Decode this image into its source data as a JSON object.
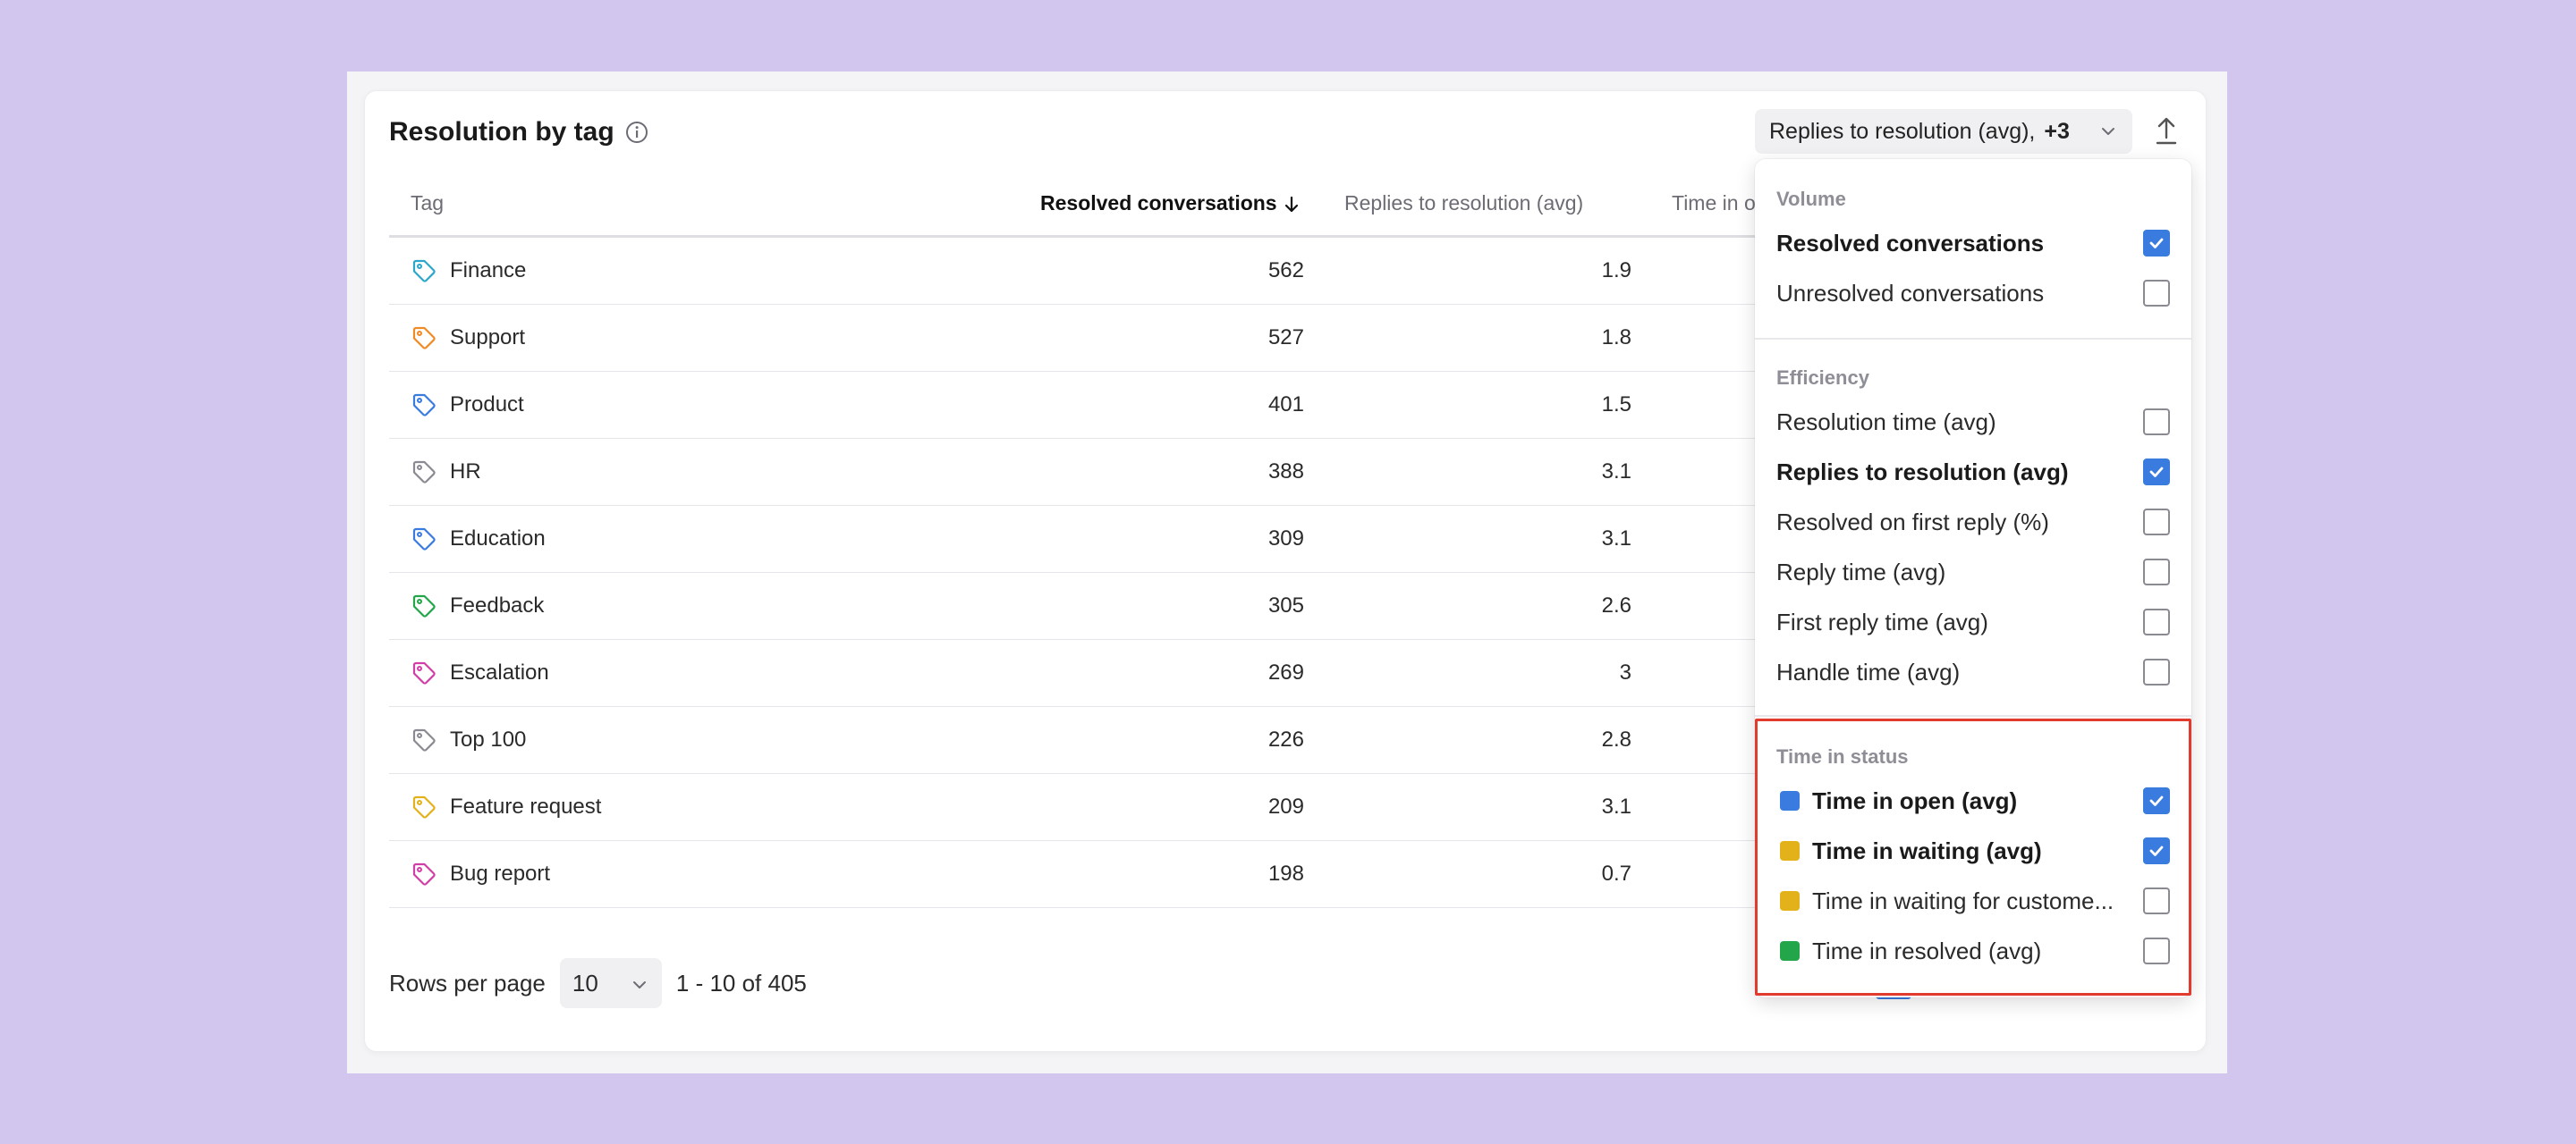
{
  "card": {
    "title": "Resolution by tag",
    "metric_select": {
      "value": "Replies to resolution (avg),",
      "extra": "+3"
    }
  },
  "table": {
    "headers": {
      "tag": "Tag",
      "resolved": "Resolved conversations",
      "replies": "Replies to resolution (avg)",
      "time_in": "Time in o"
    },
    "sort": {
      "column": "Resolved conversations",
      "direction": "descending"
    },
    "rows": [
      {
        "tag": "Finance",
        "color": "#2aa7c9",
        "resolved": "562",
        "replies": "1.9"
      },
      {
        "tag": "Support",
        "color": "#f08a24",
        "resolved": "527",
        "replies": "1.8"
      },
      {
        "tag": "Product",
        "color": "#3a7be0",
        "resolved": "401",
        "replies": "1.5"
      },
      {
        "tag": "HR",
        "color": "#8a8a92",
        "resolved": "388",
        "replies": "3.1"
      },
      {
        "tag": "Education",
        "color": "#3a7be0",
        "resolved": "309",
        "replies": "3.1"
      },
      {
        "tag": "Feedback",
        "color": "#23a64a",
        "resolved": "305",
        "replies": "2.6"
      },
      {
        "tag": "Escalation",
        "color": "#d13fa6",
        "resolved": "269",
        "replies": "3"
      },
      {
        "tag": "Top 100",
        "color": "#8a8a92",
        "resolved": "226",
        "replies": "2.8"
      },
      {
        "tag": "Feature request",
        "color": "#e3b21a",
        "resolved": "209",
        "replies": "3.1"
      },
      {
        "tag": "Bug report",
        "color": "#d13fa6",
        "resolved": "198",
        "replies": "0.7"
      }
    ]
  },
  "footer": {
    "rows_per_page_label": "Rows per page",
    "rows_per_page_value": "10",
    "range": "1 - 10 of 405"
  },
  "dropdown": {
    "sections": [
      {
        "label": "Volume",
        "options": [
          {
            "label": "Resolved conversations",
            "checked": true
          },
          {
            "label": "Unresolved conversations",
            "checked": false
          }
        ]
      },
      {
        "label": "Efficiency",
        "options": [
          {
            "label": "Resolution time (avg)",
            "checked": false
          },
          {
            "label": "Replies to resolution (avg)",
            "checked": true
          },
          {
            "label": "Resolved on first reply (%)",
            "checked": false
          },
          {
            "label": "Reply time (avg)",
            "checked": false
          },
          {
            "label": "First reply time (avg)",
            "checked": false
          },
          {
            "label": "Handle time (avg)",
            "checked": false
          }
        ]
      },
      {
        "label": "Time in status",
        "options": [
          {
            "label": "Time in open (avg)",
            "checked": true,
            "color": "#3a7be0"
          },
          {
            "label": "Time in waiting (avg)",
            "checked": true,
            "color": "#e3b21a"
          },
          {
            "label": "Time in waiting for custome...",
            "checked": false,
            "color": "#e3b21a"
          },
          {
            "label": "Time in resolved (avg)",
            "checked": false,
            "color": "#23a64a"
          }
        ]
      }
    ]
  },
  "colors": {
    "accent": "#3a7be0",
    "highlight": "#e23b2e",
    "background": "#d2c6ef"
  }
}
